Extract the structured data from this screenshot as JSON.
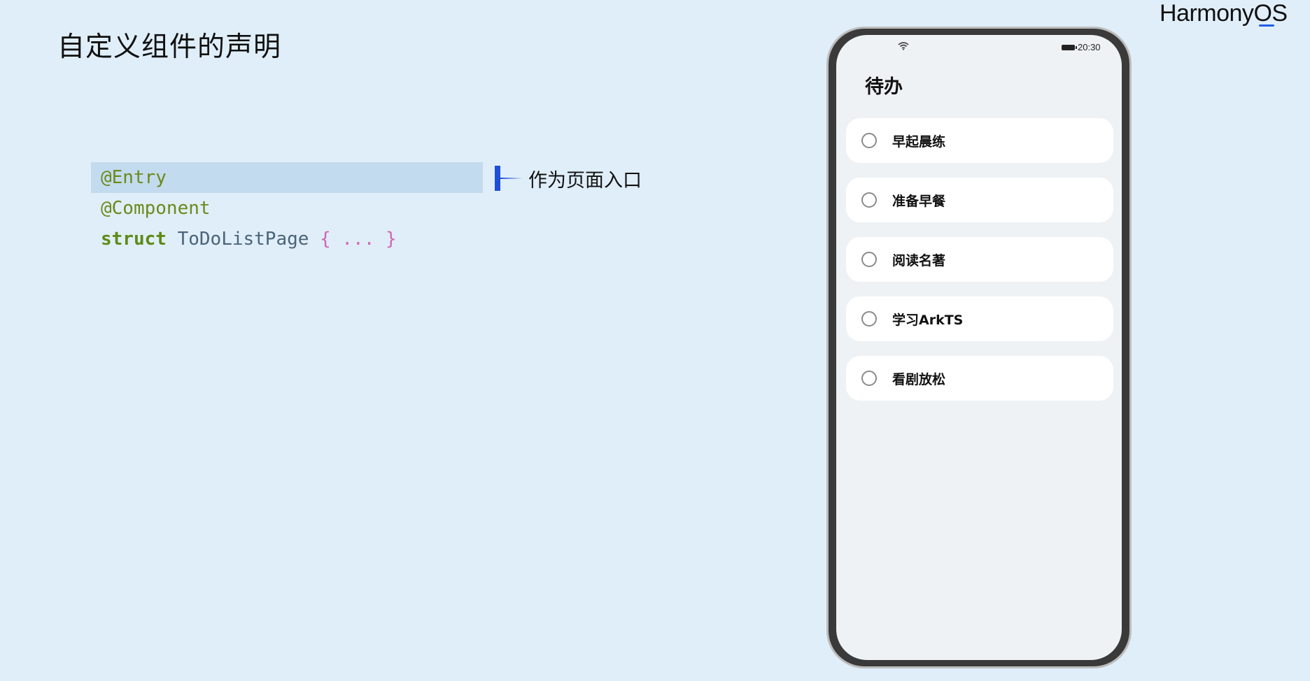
{
  "slide": {
    "title": "自定义组件的声明"
  },
  "brand": {
    "name_prefix": "Harmony",
    "name_suffix": "OS"
  },
  "code": {
    "line1": "@Entry",
    "line2": "@Component",
    "line3_keyword": "struct",
    "line3_name": "ToDoListPage",
    "line3_body": "{ ... }"
  },
  "callout": {
    "text": "作为页面入口"
  },
  "phone": {
    "status": {
      "time": "20:30",
      "wifi_icon": "wifi-icon",
      "battery_icon": "battery-icon"
    },
    "app_title": "待办",
    "todos": [
      {
        "label": "早起晨练",
        "checked": false
      },
      {
        "label": "准备早餐",
        "checked": false
      },
      {
        "label": "阅读名著",
        "checked": false
      },
      {
        "label": "学习ArkTS",
        "checked": false
      },
      {
        "label": "看剧放松",
        "checked": false
      }
    ]
  },
  "colors": {
    "background": "#e0eef9",
    "highlight": "#c3dbee",
    "accent": "#1f4fd8",
    "annotation": "#6b8a1a",
    "brace": "#d266b2"
  }
}
